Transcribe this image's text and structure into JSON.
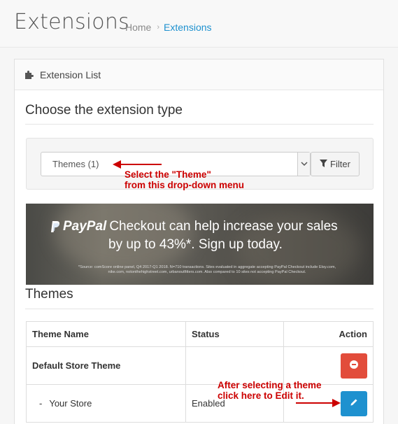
{
  "header": {
    "title": "Extensions",
    "breadcrumb": [
      {
        "label": "Home"
      },
      {
        "label": "Extensions"
      }
    ]
  },
  "panel": {
    "heading": "Extension List",
    "choose_title": "Choose the extension type",
    "select_value": "Themes (1)",
    "filter_label": "Filter",
    "themes_title": "Themes"
  },
  "annotations": {
    "select_line1": "Select the \"Theme\"",
    "select_line2": "from this drop-down menu",
    "edit_line1": "After selecting a theme",
    "edit_line2": "click here to Edit it."
  },
  "banner": {
    "brand": "PayPal",
    "line1": "Checkout can help increase your sales",
    "line2": "by up to 43%*. Sign up today.",
    "fine_print": "*Source: comScore online panel, Q4 2017-Q1 2018. N=710 transactions. Sites evaluated in aggregate accepting PayPal Checkout include Etsy.com, nike.com, notonthehighstreet.com, urbanoutfitters.com. Also compared to 10 sites not accepting PayPal Checkout."
  },
  "table": {
    "headers": [
      "Theme Name",
      "Status",
      "Action"
    ],
    "group_row": "Default Store Theme",
    "theme_row": {
      "prefix": "-",
      "name": "Your Store",
      "status": "Enabled"
    }
  },
  "colors": {
    "accent": "#1e91cf",
    "danger": "#e24c3b",
    "annotation": "#cc0000"
  },
  "icons": {
    "panel": "puzzle-icon",
    "filter": "filter-icon",
    "uninstall": "minus-circle-icon",
    "edit": "pencil-icon",
    "paypal": "paypal-logo-icon"
  }
}
